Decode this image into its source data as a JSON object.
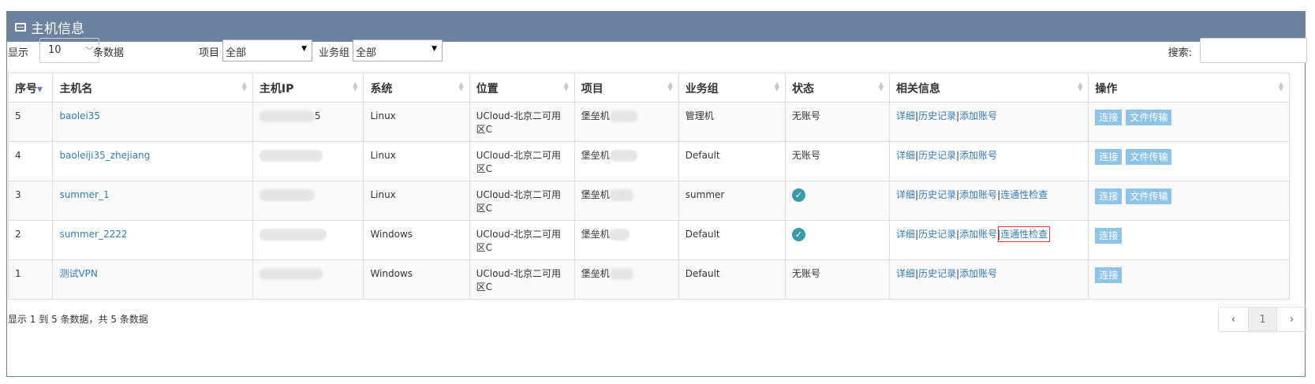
{
  "panel": {
    "title": "主机信息"
  },
  "toolbar": {
    "show_label": "显示",
    "page_size": "10",
    "rows_label": "条数据",
    "project_label": "项目",
    "project_value": "全部",
    "group_label": "业务组",
    "group_value": "全部",
    "search_label": "搜索:",
    "search_value": ""
  },
  "table": {
    "columns": [
      "序号",
      "主机名",
      "主机IP",
      "系统",
      "位置",
      "项目",
      "业务组",
      "状态",
      "相关信息",
      "操作"
    ],
    "rows": [
      {
        "id": "5",
        "name": "baolei35",
        "ip_suffix": "5",
        "os": "Linux",
        "loc1": "UCloud-北京二可用",
        "loc2": "区C",
        "project": "堡垒机",
        "group": "管理机",
        "status": "无账号",
        "status_ok": false,
        "links": [
          "详细",
          "历史记录",
          "添加账号"
        ],
        "buttons": [
          "连接",
          "文件传输"
        ]
      },
      {
        "id": "4",
        "name": "baoleiji35_zhejiang",
        "ip_suffix": "",
        "os": "Linux",
        "loc1": "UCloud-北京二可用",
        "loc2": "区C",
        "project": "堡垒机",
        "group": "Default",
        "status": "无账号",
        "status_ok": false,
        "links": [
          "详细",
          "历史记录",
          "添加账号"
        ],
        "buttons": [
          "连接",
          "文件传输"
        ]
      },
      {
        "id": "3",
        "name": "summer_1",
        "ip_suffix": "",
        "os": "Linux",
        "loc1": "UCloud-北京二可用",
        "loc2": "区C",
        "project": "堡垒机",
        "group": "summer",
        "status": "",
        "status_ok": true,
        "links": [
          "详细",
          "历史记录",
          "添加账号",
          "连通性检查"
        ],
        "buttons": [
          "连接",
          "文件传输"
        ]
      },
      {
        "id": "2",
        "name": "summer_2222",
        "ip_suffix": "",
        "os": "Windows",
        "loc1": "UCloud-北京二可用",
        "loc2": "区C",
        "project": "堡垒机",
        "group": "Default",
        "status": "",
        "status_ok": true,
        "links": [
          "详细",
          "历史记录",
          "添加账号",
          "连通性检查"
        ],
        "buttons": [
          "连接"
        ]
      },
      {
        "id": "1",
        "name": "测试VPN",
        "ip_suffix": "",
        "os": "Windows",
        "loc1": "UCloud-北京二可用",
        "loc2": "区C",
        "project": "堡垒机",
        "group": "Default",
        "status": "无账号",
        "status_ok": false,
        "links": [
          "详细",
          "历史记录",
          "添加账号"
        ],
        "buttons": [
          "连接"
        ]
      }
    ]
  },
  "footer": {
    "info": "显示 1 到 5 条数据，共 5 条数据",
    "prev": "‹",
    "current_page": "1",
    "next": "›"
  },
  "icons": {
    "panel_icon": "window-icon",
    "status_ok": "check-circle-icon",
    "sort": "sort-icon"
  },
  "colors": {
    "header_bg": "#6a819f",
    "link": "#337ab7",
    "button_bg": "#8ec4e8",
    "status_ok": "#3a9ba8",
    "highlight": "#e53935"
  },
  "highlighted_link": {
    "row": 3,
    "label": "连通性检查"
  }
}
